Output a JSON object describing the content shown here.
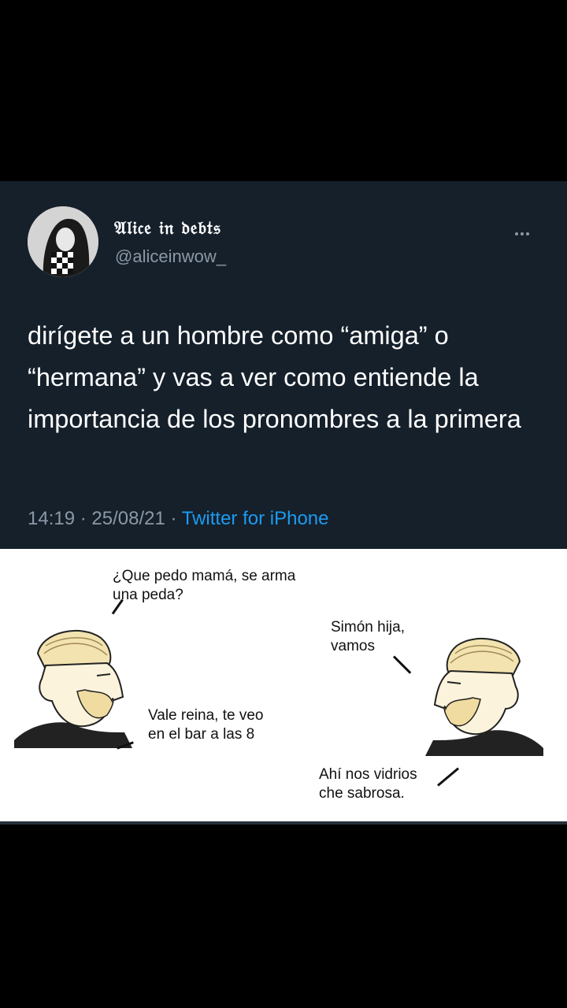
{
  "tweet": {
    "display_name": "𝔄𝔩𝔦𝔠𝔢 𝔦𝔫 𝔡𝔢𝔟𝔱𝔰",
    "handle": "@aliceinwow_",
    "text": "dirígete a un hombre como “amiga” o “hermana” y vas a ver como entiende la importancia de los pronombres a la primera",
    "time": "14:19",
    "date": "25/08/21",
    "source": "Twitter for iPhone"
  },
  "meme": {
    "left_top_caption": "¿Que pedo mamá, se arma\nuna peda?",
    "left_bottom_caption": "Vale reina, te veo\nen el bar a las 8",
    "right_top_caption": "Simón hija,\nvamos",
    "right_bottom_caption": "Ahí nos vidrios\nche sabrosa."
  },
  "colors": {
    "tweet_bg": "#15202b",
    "link": "#1d9bf0",
    "muted": "#8b98a5"
  }
}
